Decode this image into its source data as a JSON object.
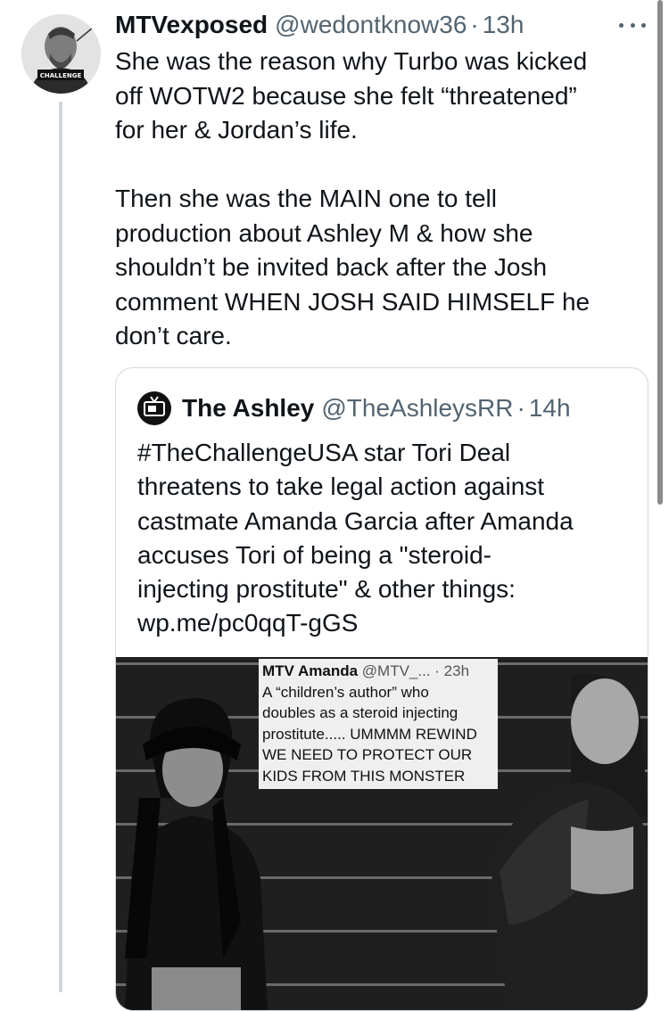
{
  "tweet": {
    "author_name": "MTVexposed",
    "author_handle": "@wedontknow36",
    "separator": "·",
    "time": "13h",
    "text": "She was the reason why Turbo was kicked\noff WOTW2 because she felt “threatened”\nfor her & Jordan’s life.\n\nThen she was the MAIN one to tell\nproduction about Ashley M & how she\nshouldn’t be invited back after the Josh\ncomment WHEN JOSH SAID HIMSELF he\ndon’t care.",
    "avatar_badge": "CHALLENGE"
  },
  "quote": {
    "author_name": "The Ashley",
    "author_handle": "@TheAshleysRR",
    "separator": "·",
    "time": "14h",
    "text": "#TheChallengeUSA star Tori Deal\nthreatens to take legal action against\ncastmate Amanda Garcia after Amanda\naccuses Tori of being a \"steroid-\ninjecting prostitute\" & other things:\nwp.me/pc0qqT-gGS"
  },
  "embedded": {
    "author_name": "MTV Amanda",
    "handle": "@MTV_...",
    "time": "· 23h",
    "lines": [
      "A “children’s author” who",
      "doubles as a steroid injecting",
      "prostitute..... UMMMM REWIND",
      "WE NEED TO PROTECT OUR",
      "KIDS FROM THIS MONSTER"
    ]
  },
  "colors": {
    "text": "#0f1419",
    "secondary": "#536471",
    "border": "#cfd9de"
  },
  "icons": {
    "more": "more-horizontal-icon"
  }
}
